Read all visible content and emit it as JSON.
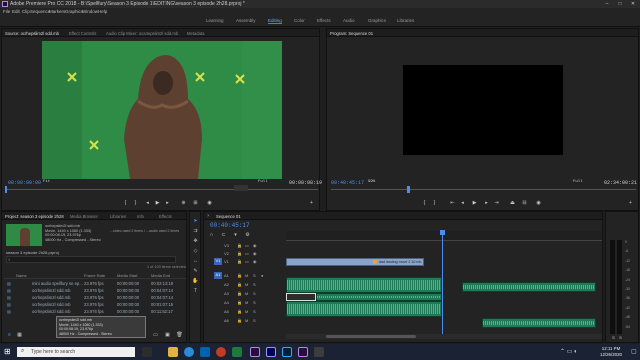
{
  "window": {
    "title": "Adobe Premiere Pro CC 2018 - B:\\Spellfury\\Season 3 Episode 1\\EDITING\\season 3 episode 2h28.prproj *"
  },
  "menu": [
    "File",
    "Edit",
    "Clip",
    "Sequence",
    "Markers",
    "Graphics",
    "Window",
    "Help"
  ],
  "workspaces": {
    "items": [
      "Learning",
      "Assembly",
      "Editing",
      "Color",
      "Effects",
      "Audio",
      "Graphics",
      "Libraries"
    ],
    "active_index": 2
  },
  "source": {
    "tabs": [
      "Source: ocrhepslim2l sdd.mb",
      "Effect Controls",
      "Audio Clip Mixer: oca4epslim2l sdd.mb",
      "Metadata"
    ],
    "timecode_left": "00:00:00:00",
    "fit": "Fit",
    "full": "Full",
    "timecode_right": "00:00:08:19",
    "footage_bg": "#2e8a45"
  },
  "program": {
    "tabs": [
      "Program: Sequence 01"
    ],
    "timecode_left": "00:40:45:17",
    "fit": "99%",
    "full": "Full",
    "timecode_right": "02:34:00:21"
  },
  "project": {
    "tabs": [
      "Project: season 3 episode 2h28",
      "Media Browser",
      "Libraries",
      "Info",
      "Effects"
    ],
    "clip_name": "ocrhepslim2l sdd.mb",
    "clip_info": [
      "Movie, 1440 x 1080 (1.333)",
      "00:00:08:19, 23.976p",
      "48000 Hz - Compressed - Stereo"
    ],
    "clip_extra": "...video used 2 times / ...audio used 2 times",
    "breadcrumb": "season 3 episode 2h28.prproj",
    "count_label": "1 of 103 items selected",
    "columns": [
      "Name",
      "Frame Rate",
      "Media Start",
      "Media End"
    ],
    "rows": [
      {
        "name": "mini audio spellfury se ep...",
        "rate": "23.976 fps",
        "start": "00:00:00:00",
        "end": "00:02:13:19"
      },
      {
        "name": "ocrhepslim2l sdd.mb",
        "rate": "23.976 fps",
        "start": "00:00:00:00",
        "end": "00:04:07:14"
      },
      {
        "name": "ocrhepslim2l sdd.mb",
        "rate": "23.976 fps",
        "start": "00:00:00:00",
        "end": "00:04:07:14"
      },
      {
        "name": "ocrhepslim2l sdd.mb",
        "rate": "23.976 fps",
        "start": "00:00:00:00",
        "end": "00:01:07:15"
      },
      {
        "name": "ocrhepslim2l sdd.mb",
        "rate": "23.976 fps",
        "start": "00:00:00:00",
        "end": "00:11:52:17"
      }
    ],
    "tooltip": [
      "ocrhepslim2l sdd.mb",
      "Movie, 1440 x 1080 (1.333)",
      "00:00:08:19, 23.976p",
      "48000 Hz - Compressed - Stereo"
    ]
  },
  "timeline": {
    "tabs": [
      "Sequence 01"
    ],
    "timecode": "00:40:45:17",
    "track_labels": [
      "V3",
      "V2",
      "V1",
      "A1",
      "A2",
      "A3",
      "A4",
      "A5",
      "A6"
    ],
    "video_clip_label": "dad landing move 2 10 mb",
    "meter_labels": [
      "0",
      "-6",
      "-12",
      "-18",
      "-24",
      "-30",
      "-36",
      "-42",
      "-48",
      "-54"
    ]
  },
  "taskbar": {
    "search_placeholder": "Type here to search",
    "time": "12:11 PM",
    "date": "12/26/2020"
  }
}
